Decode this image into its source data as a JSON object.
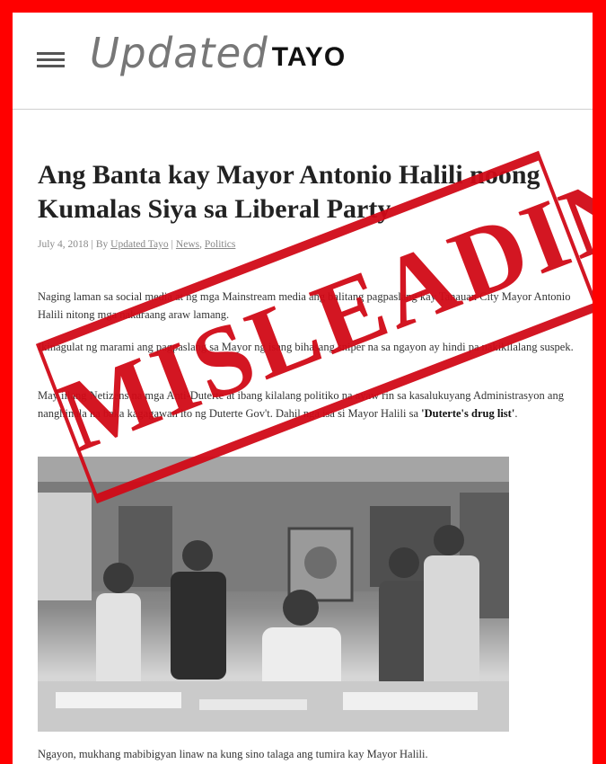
{
  "site": {
    "logo_script": "Updated",
    "logo_caps": "TAYO"
  },
  "article": {
    "title": "Ang Banta kay Mayor Antonio Halili noong Kumalas Siya sa Liberal Party",
    "date": "July 4, 2018",
    "by_label": "By",
    "author": "Updated Tayo",
    "categories": [
      "News",
      "Politics"
    ],
    "paragraphs": [
      "Naging laman sa social media at ng mga Mainstream media ang balitang pagpaslang kay Tanauan City Mayor Antonio Halili nitong mga nakaraang araw lamang.",
      "Ikinagulat ng marami ang pagpaslang sa Mayor ng isang bihasang sniper na sa ngayon ay hindi pa nakikilalang suspek.",
      "May iilang Netizens na mga Anti-Duterte at ibang kilalang politiko na ayaw rin sa kasalukuyang Administrasyon ang nanghinala na baka kagagawan ito ng Duterte Gov't. Dahil nga isa si Mayor Halili sa",
      "Ngayon, mukhang mabibigyan linaw na kung sino talaga ang tumira kay Mayor Halili."
    ],
    "p3_bold_anti": "Anti-Duterte",
    "p3_quote": "'Duterte's drug list'",
    "p3_end": "."
  },
  "photo": {
    "description_icon": "photo-image"
  },
  "stamp": {
    "text": "MISLEADING",
    "color": "#d10a17"
  },
  "colors": {
    "frame": "#ff0000"
  }
}
